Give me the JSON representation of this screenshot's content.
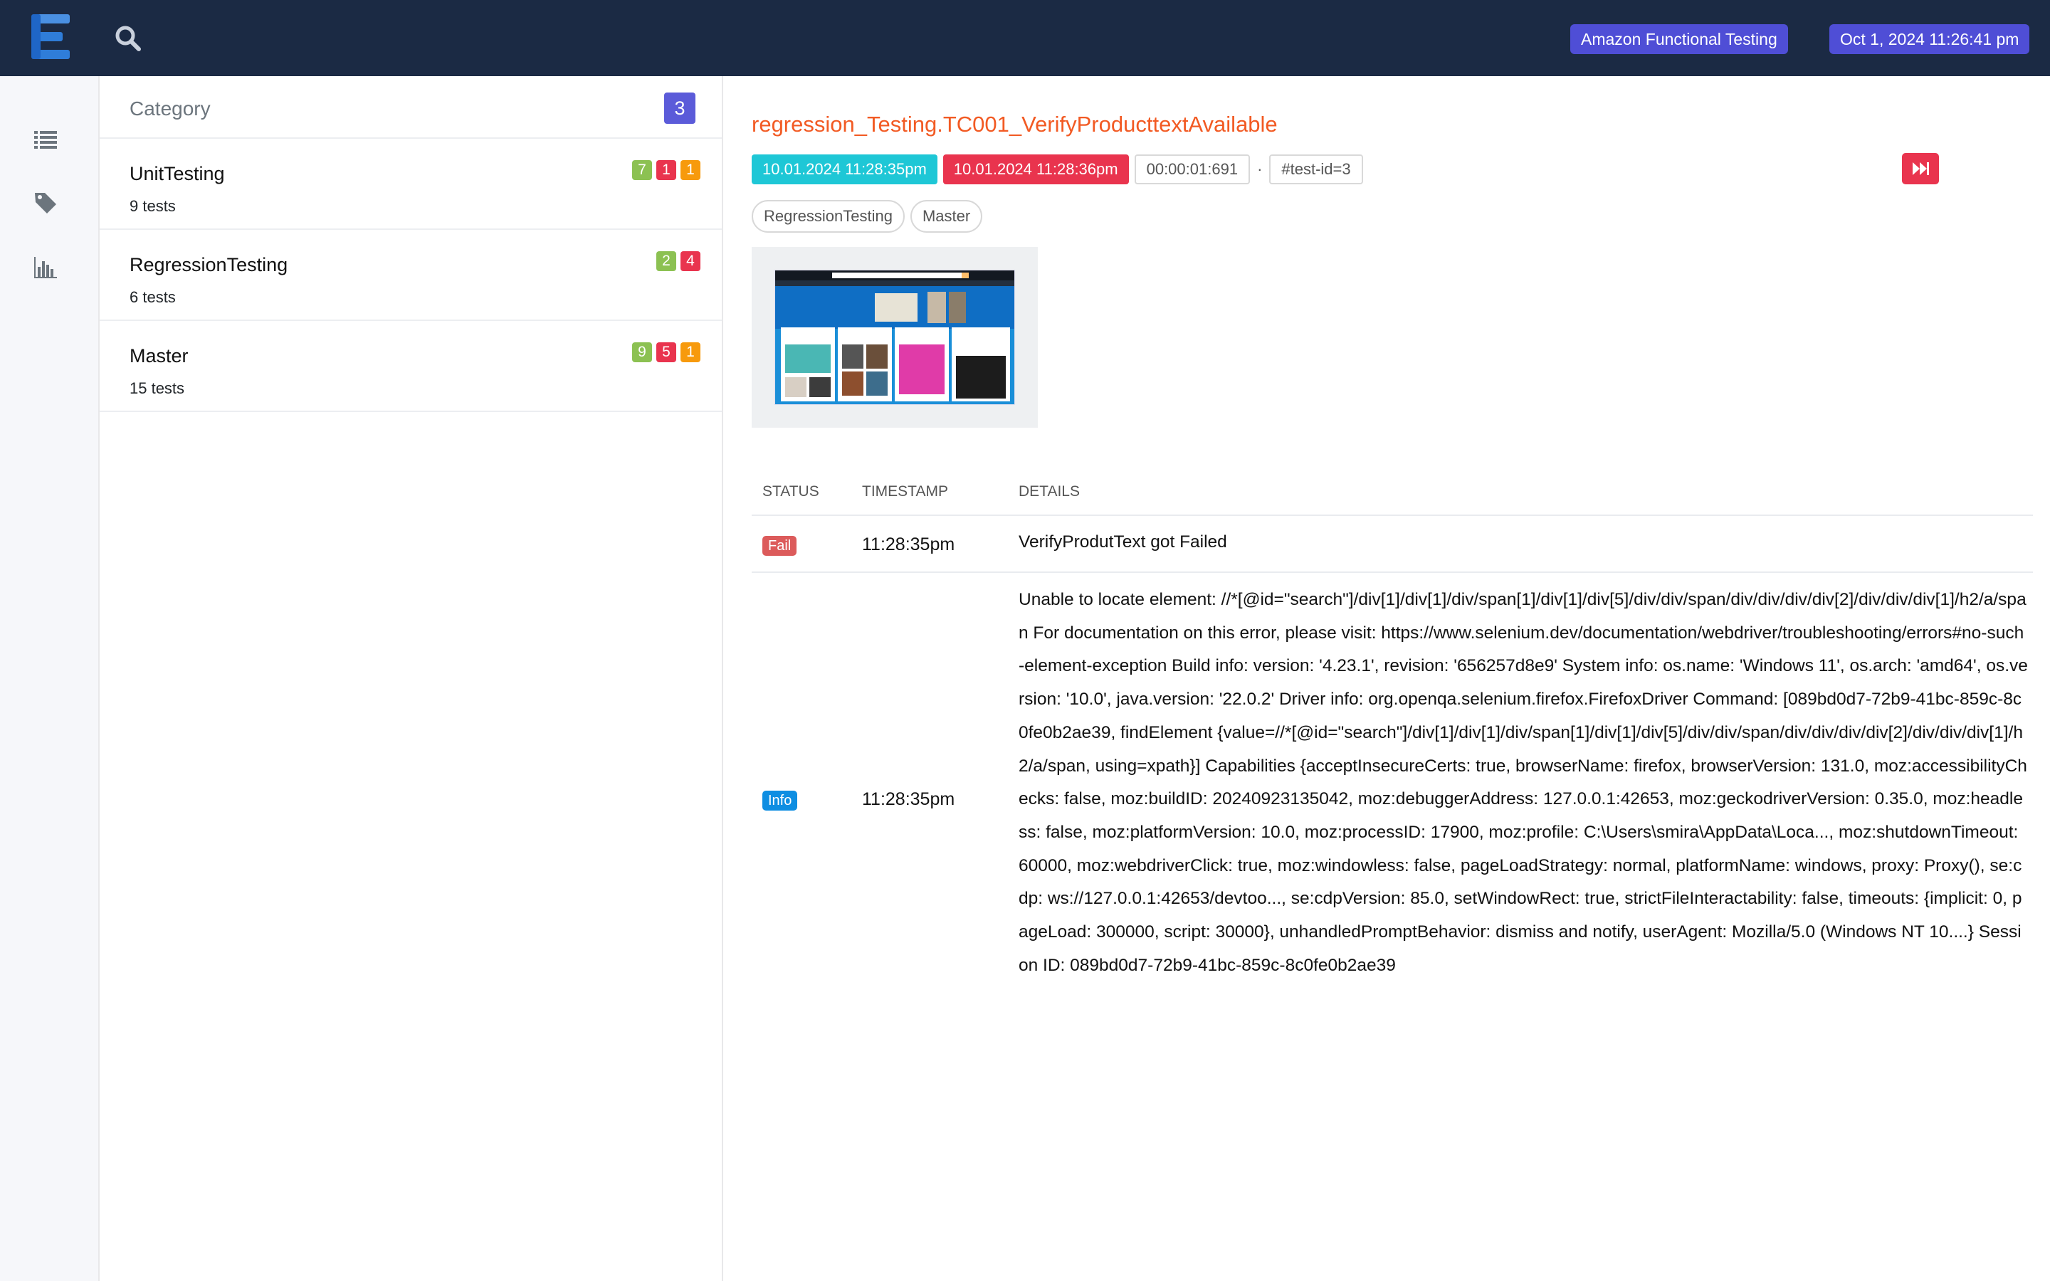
{
  "topbar": {
    "logo_icon": "extent-logo-icon",
    "search_icon": "search-icon",
    "project_badge": "Amazon Functional Testing",
    "date_badge": "Oct 1, 2024 11:26:41 pm"
  },
  "leftnav": {
    "items": [
      {
        "icon": "list-icon"
      },
      {
        "icon": "tag-icon"
      },
      {
        "icon": "bar-chart-icon"
      }
    ]
  },
  "category_panel": {
    "title": "Category",
    "count": "3",
    "items": [
      {
        "name": "UnitTesting",
        "tests": "9 tests",
        "pass": "7",
        "fail": "1",
        "skip": "1"
      },
      {
        "name": "RegressionTesting",
        "tests": "6 tests",
        "pass": "2",
        "fail": "4",
        "skip": ""
      },
      {
        "name": "Master",
        "tests": "15 tests",
        "pass": "9",
        "fail": "5",
        "skip": "1"
      }
    ]
  },
  "detail": {
    "test_name": "regression_Testing.TC001_VerifyProducttextAvailable",
    "start_time": "10.01.2024 11:28:35pm",
    "end_time": "10.01.2024 11:28:36pm",
    "duration": "00:00:01:691",
    "separator": "·",
    "test_id": "#test-id=3",
    "skip_icon": "fast-forward-icon",
    "tags": [
      "RegressionTesting",
      "Master"
    ],
    "colors": {
      "accent_orange": "#f25a23",
      "pass": "#8cc152",
      "fail": "#e9344e",
      "skip": "#f79a0c",
      "info": "#0e8ee2"
    }
  },
  "log": {
    "headers": {
      "status": "Status",
      "timestamp": "Timestamp",
      "details": "Details"
    },
    "rows": [
      {
        "status": "Fail",
        "time": "11:28:35pm",
        "details": "VerifyProdutText got Failed"
      },
      {
        "status": "Info",
        "time": "11:28:35pm",
        "details": "Unable to locate element: //*[@id=\"search\"]/div[1]/div[1]/div/span[1]/div[1]/div[5]/div/div/span/div/div/div/div[2]/div/div/div[1]/h2/a/span For documentation on this error, please visit: https://www.selenium.dev/documentation/webdriver/troubleshooting/errors#no-such-element-exception Build info: version: '4.23.1', revision: '656257d8e9' System info: os.name: 'Windows 11', os.arch: 'amd64', os.version: '10.0', java.version: '22.0.2' Driver info: org.openqa.selenium.firefox.FirefoxDriver Command: [089bd0d7-72b9-41bc-859c-8c0fe0b2ae39, findElement {value=//*[@id=\"search\"]/div[1]/div[1]/div/span[1]/div[1]/div[5]/div/div/span/div/div/div/div[2]/div/div/div[1]/h2/a/span, using=xpath}] Capabilities {acceptInsecureCerts: true, browserName: firefox, browserVersion: 131.0, moz:accessibilityChecks: false, moz:buildID: 20240923135042, moz:debuggerAddress: 127.0.0.1:42653, moz:geckodriverVersion: 0.35.0, moz:headless: false, moz:platformVersion: 10.0, moz:processID: 17900, moz:profile: C:\\Users\\smira\\AppData\\Loca..., moz:shutdownTimeout: 60000, moz:webdriverClick: true, moz:windowless: false, pageLoadStrategy: normal, platformName: windows, proxy: Proxy(), se:cdp: ws://127.0.0.1:42653/devtoo..., se:cdpVersion: 85.0, setWindowRect: true, strictFileInteractability: false, timeouts: {implicit: 0, pageLoad: 300000, script: 30000}, unhandledPromptBehavior: dismiss and notify, userAgent: Mozilla/5.0 (Windows NT 10....} Session ID: 089bd0d7-72b9-41bc-859c-8c0fe0b2ae39"
      }
    ]
  }
}
